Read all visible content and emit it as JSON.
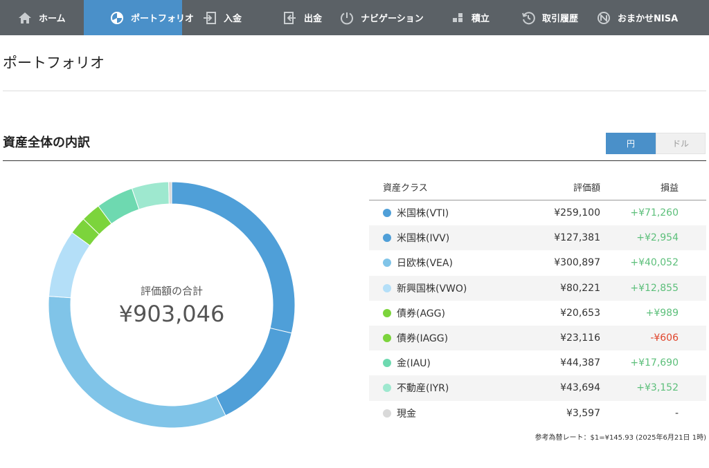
{
  "nav": {
    "items": [
      {
        "label": "ホーム",
        "icon": "home-icon",
        "active": false
      },
      {
        "label": "ポートフォリオ",
        "icon": "pie-chart-icon",
        "active": true
      },
      {
        "label": "入金",
        "icon": "deposit-icon",
        "active": false
      },
      {
        "label": "出金",
        "icon": "withdraw-icon",
        "active": false
      },
      {
        "label": "ナビゲーション",
        "icon": "navigation-icon",
        "active": false
      },
      {
        "label": "積立",
        "icon": "blocks-icon",
        "active": false
      },
      {
        "label": "取引履歴",
        "icon": "history-icon",
        "active": false
      },
      {
        "label": "おまかせNISA",
        "icon": "nisa-icon",
        "active": false
      }
    ]
  },
  "page": {
    "title": "ポートフォリオ"
  },
  "section": {
    "title": "資産全体の内訳"
  },
  "currency_toggle": {
    "yen": "円",
    "dollar": "ドル",
    "selected": "円"
  },
  "donut": {
    "label": "評価額の合計",
    "total": "¥903,046"
  },
  "table": {
    "headers": {
      "class": "資産クラス",
      "value": "評価額",
      "pl": "損益"
    },
    "rows": [
      {
        "name": "米国株(VTI)",
        "value": "¥259,100",
        "pl": "+¥71,260",
        "pl_sign": "pos",
        "color": "#4f9fd8",
        "amount": 259100
      },
      {
        "name": "米国株(IVV)",
        "value": "¥127,381",
        "pl": "+¥2,954",
        "pl_sign": "pos",
        "color": "#4f9fd8",
        "amount": 127381
      },
      {
        "name": "日欧株(VEA)",
        "value": "¥300,897",
        "pl": "+¥40,052",
        "pl_sign": "pos",
        "color": "#80c4e8",
        "amount": 300897
      },
      {
        "name": "新興国株(VWO)",
        "value": "¥80,221",
        "pl": "+¥12,855",
        "pl_sign": "pos",
        "color": "#b4dff8",
        "amount": 80221
      },
      {
        "name": "債券(AGG)",
        "value": "¥20,653",
        "pl": "+¥989",
        "pl_sign": "pos",
        "color": "#7cd43c",
        "amount": 20653
      },
      {
        "name": "債券(IAGG)",
        "value": "¥23,116",
        "pl": "-¥606",
        "pl_sign": "neg",
        "color": "#7cd43c",
        "amount": 23116
      },
      {
        "name": "金(IAU)",
        "value": "¥44,387",
        "pl": "+¥17,690",
        "pl_sign": "pos",
        "color": "#6ed9b0",
        "amount": 44387
      },
      {
        "name": "不動産(IYR)",
        "value": "¥43,694",
        "pl": "+¥3,152",
        "pl_sign": "pos",
        "color": "#9ee8cf",
        "amount": 43694
      },
      {
        "name": "現金",
        "value": "¥3,597",
        "pl": "-",
        "pl_sign": "neu",
        "color": "#d9d9d9",
        "amount": 3597
      }
    ]
  },
  "footnote": "参考為替レート：$1=¥145.93 (2025年6月21日 1時)"
}
